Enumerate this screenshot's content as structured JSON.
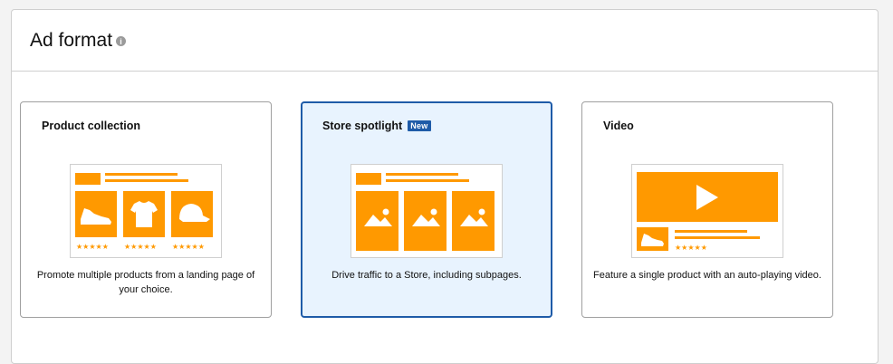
{
  "section": {
    "title": "Ad format",
    "info_icon": "info-icon"
  },
  "colors": {
    "accent_orange": "#ff9900",
    "selected_border": "#1e5ba8",
    "selected_bg": "#e8f3fe"
  },
  "cards": [
    {
      "title": "Product collection",
      "badge": "",
      "description": "Promote multiple products from a landing page of your choice.",
      "selected": false,
      "icons": [
        "sneaker-icon",
        "tshirt-icon",
        "cap-icon",
        "star-rating-icon"
      ]
    },
    {
      "title": "Store spotlight",
      "badge": "New",
      "description": "Drive traffic to a Store, including subpages.",
      "selected": true,
      "icons": [
        "image-placeholder-icon"
      ]
    },
    {
      "title": "Video",
      "badge": "",
      "description": "Feature a single product with an auto-playing video.",
      "selected": false,
      "icons": [
        "play-icon",
        "sneaker-icon",
        "star-rating-icon"
      ]
    }
  ]
}
